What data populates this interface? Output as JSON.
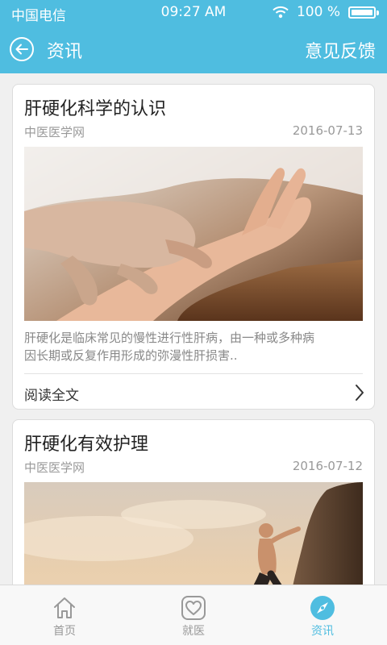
{
  "status_bar": {
    "carrier": "中国电信",
    "time": "09:27 AM",
    "battery": "100 %"
  },
  "nav": {
    "back_icon": "back-arrow-icon",
    "title": "资讯",
    "feedback": "意见反馈"
  },
  "articles": [
    {
      "title": "肝硬化科学的认识",
      "source": "中医医学网",
      "date": "2016-07-13",
      "summary_line1": "肝硬化是临床常见的慢性进行性肝病，由一种或多种病",
      "summary_line2": "因长期或反复作用形成的弥漫性肝损害..",
      "read_more": "阅读全文"
    },
    {
      "title": "肝硬化有效护理",
      "source": "中医医学网",
      "date": "2016-07-12"
    }
  ],
  "tabs": [
    {
      "label": "首页",
      "icon": "home-icon"
    },
    {
      "label": "就医",
      "icon": "heart-icon"
    },
    {
      "label": "资讯",
      "icon": "compass-icon"
    }
  ],
  "colors": {
    "accent": "#4fbde0",
    "background": "#f0f0f0",
    "tab_inactive": "#999999"
  }
}
